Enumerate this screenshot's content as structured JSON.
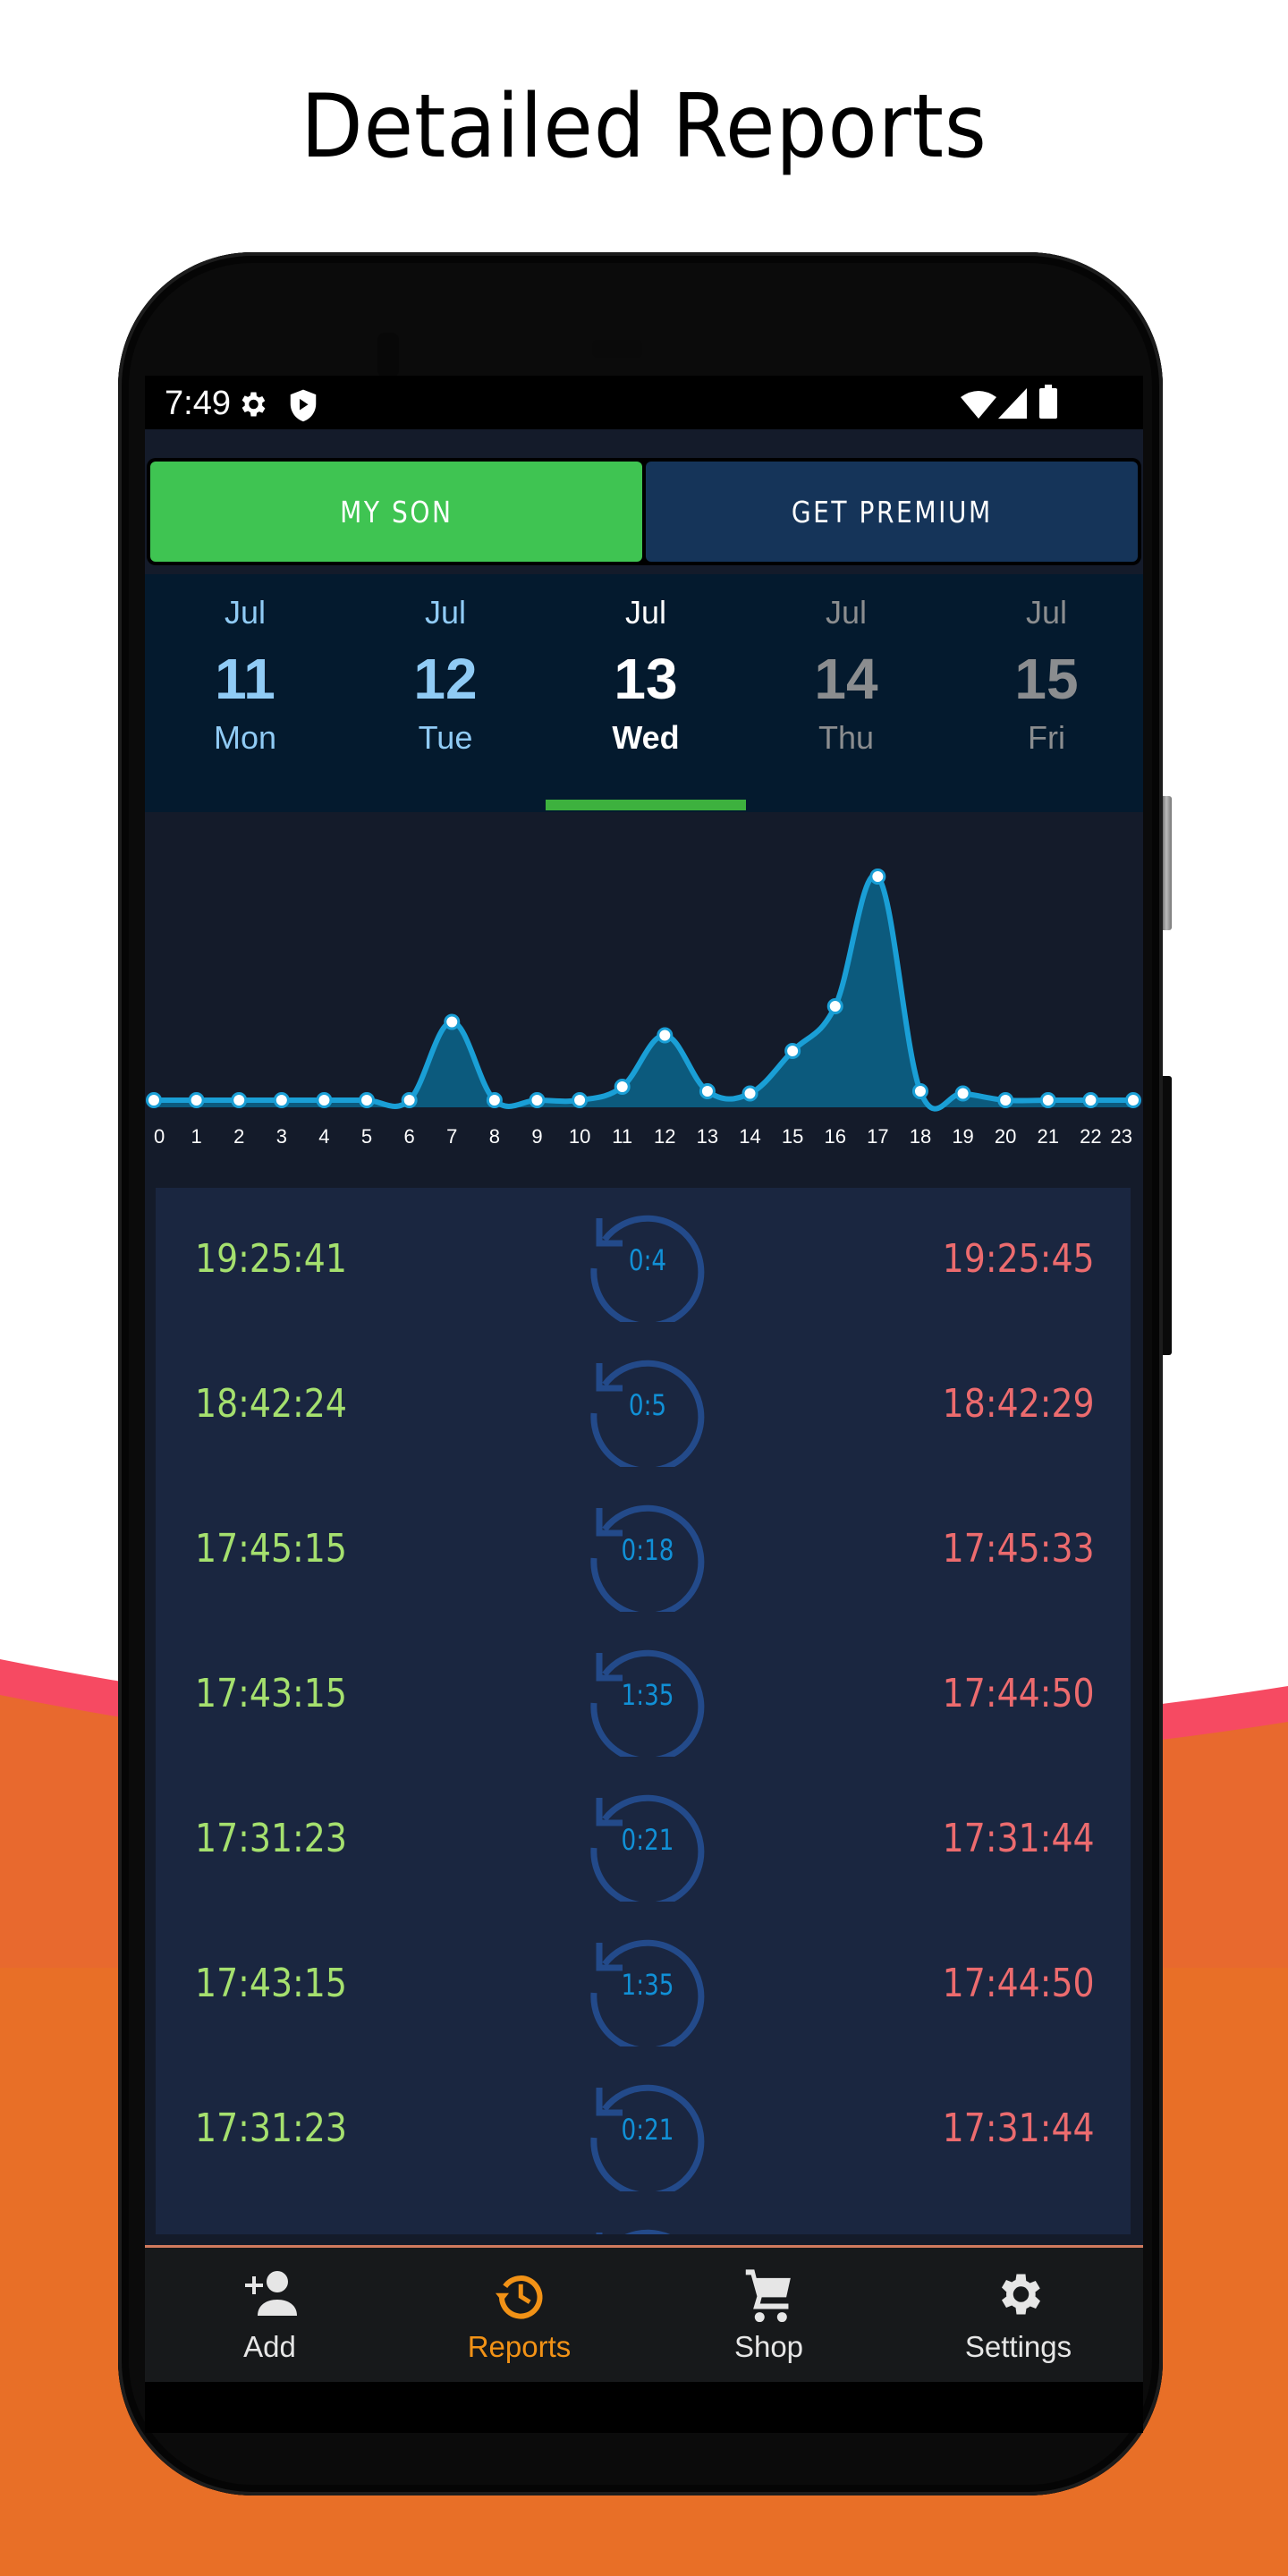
{
  "headline": "Detailed Reports",
  "colors": {
    "tab_active": "#3fc452",
    "tab_premium": "#153459",
    "date_indicator": "#3db13e",
    "chart_line": "#1a9fd6",
    "chart_fill": "#0c5a7d",
    "start_time": "#a5e06e",
    "end_time": "#ec6b6e",
    "duration": "#1190d6",
    "nav_active": "#f29216",
    "bg_orange": "#e8702a",
    "bg_pink": "#f64a62"
  },
  "status_bar": {
    "time": "7:49",
    "left_icons": [
      "gear-icon",
      "shield-play-icon"
    ],
    "right_icons": [
      "wifi-icon",
      "signal-icon",
      "battery-icon"
    ]
  },
  "tabs": [
    {
      "label": "MY SON",
      "active": true
    },
    {
      "label": "GET PREMIUM",
      "active": false
    }
  ],
  "dates": [
    {
      "month": "Jul",
      "day": "11",
      "dow": "Mon",
      "state": "past"
    },
    {
      "month": "Jul",
      "day": "12",
      "dow": "Tue",
      "state": "past"
    },
    {
      "month": "Jul",
      "day": "13",
      "dow": "Wed",
      "state": "current"
    },
    {
      "month": "Jul",
      "day": "14",
      "dow": "Thu",
      "state": "future"
    },
    {
      "month": "Jul",
      "day": "15",
      "dow": "Fri",
      "state": "future"
    }
  ],
  "chart_data": {
    "type": "area",
    "title": "",
    "xlabel": "",
    "ylabel": "",
    "x": [
      0,
      1,
      2,
      3,
      4,
      5,
      6,
      7,
      8,
      9,
      10,
      11,
      12,
      13,
      14,
      15,
      16,
      17,
      18,
      19,
      20,
      21,
      22,
      23
    ],
    "x_tick_labels": [
      "0",
      "1",
      "2",
      "3",
      "4",
      "5",
      "6",
      "7",
      "8",
      "9",
      "10",
      "11",
      "12",
      "13",
      "14",
      "15",
      "16",
      "17",
      "18",
      "19",
      "20",
      "21",
      "22",
      "23"
    ],
    "values": [
      0,
      0,
      0,
      0,
      0,
      0,
      0,
      35,
      0,
      0,
      0,
      6,
      29,
      4,
      3,
      22,
      42,
      100,
      4,
      3,
      0,
      0,
      0,
      0
    ],
    "ylim": [
      0,
      100
    ],
    "grid": false,
    "legend": "none"
  },
  "sessions": [
    {
      "start": "19:25:41",
      "duration": "0:4",
      "end": "19:25:45"
    },
    {
      "start": "18:42:24",
      "duration": "0:5",
      "end": "18:42:29"
    },
    {
      "start": "17:45:15",
      "duration": "0:18",
      "end": "17:45:33"
    },
    {
      "start": "17:43:15",
      "duration": "1:35",
      "end": "17:44:50"
    },
    {
      "start": "17:31:23",
      "duration": "0:21",
      "end": "17:31:44"
    },
    {
      "start": "17:43:15",
      "duration": "1:35",
      "end": "17:44:50"
    },
    {
      "start": "17:31:23",
      "duration": "0:21",
      "end": "17:31:44"
    }
  ],
  "bottom_nav": [
    {
      "label": "Add",
      "icon": "add-person-icon",
      "active": false
    },
    {
      "label": "Reports",
      "icon": "history-icon",
      "active": true
    },
    {
      "label": "Shop",
      "icon": "cart-icon",
      "active": false
    },
    {
      "label": "Settings",
      "icon": "gear-icon",
      "active": false
    }
  ]
}
